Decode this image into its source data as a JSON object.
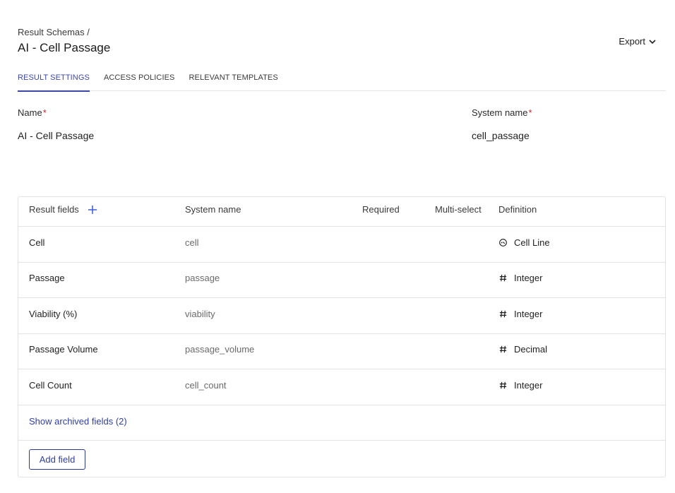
{
  "header": {
    "breadcrumb": "Result Schemas /",
    "title": "AI - Cell Passage",
    "export_label": "Export"
  },
  "tabs": [
    {
      "label": "RESULT SETTINGS",
      "active": true
    },
    {
      "label": "ACCESS POLICIES",
      "active": false
    },
    {
      "label": "RELEVANT TEMPLATES",
      "active": false
    }
  ],
  "settings": {
    "name_label": "Name",
    "name_value": "AI - Cell Passage",
    "system_name_label": "System name",
    "system_name_value": "cell_passage",
    "required_marker": "*"
  },
  "table": {
    "columns": [
      "Result fields",
      "System name",
      "Required",
      "Multi-select",
      "Definition"
    ],
    "rows": [
      {
        "name": "Cell",
        "system_name": "cell",
        "definition": "Cell Line",
        "icon": "entity-link-icon"
      },
      {
        "name": "Passage",
        "system_name": "passage",
        "definition": "Integer",
        "icon": "hash-icon"
      },
      {
        "name": "Viability (%)",
        "system_name": "viability",
        "definition": "Integer",
        "icon": "hash-icon"
      },
      {
        "name": "Passage Volume",
        "system_name": "passage_volume",
        "definition": "Decimal",
        "icon": "hash-icon"
      },
      {
        "name": "Cell Count",
        "system_name": "cell_count",
        "definition": "Integer",
        "icon": "hash-icon"
      }
    ],
    "archived_link": "Show archived fields (2)",
    "add_button": "Add field"
  },
  "colors": {
    "accent": "#3a47a8",
    "link": "#2f3f9f",
    "required": "#c0282d",
    "border": "#e3e3e3"
  }
}
